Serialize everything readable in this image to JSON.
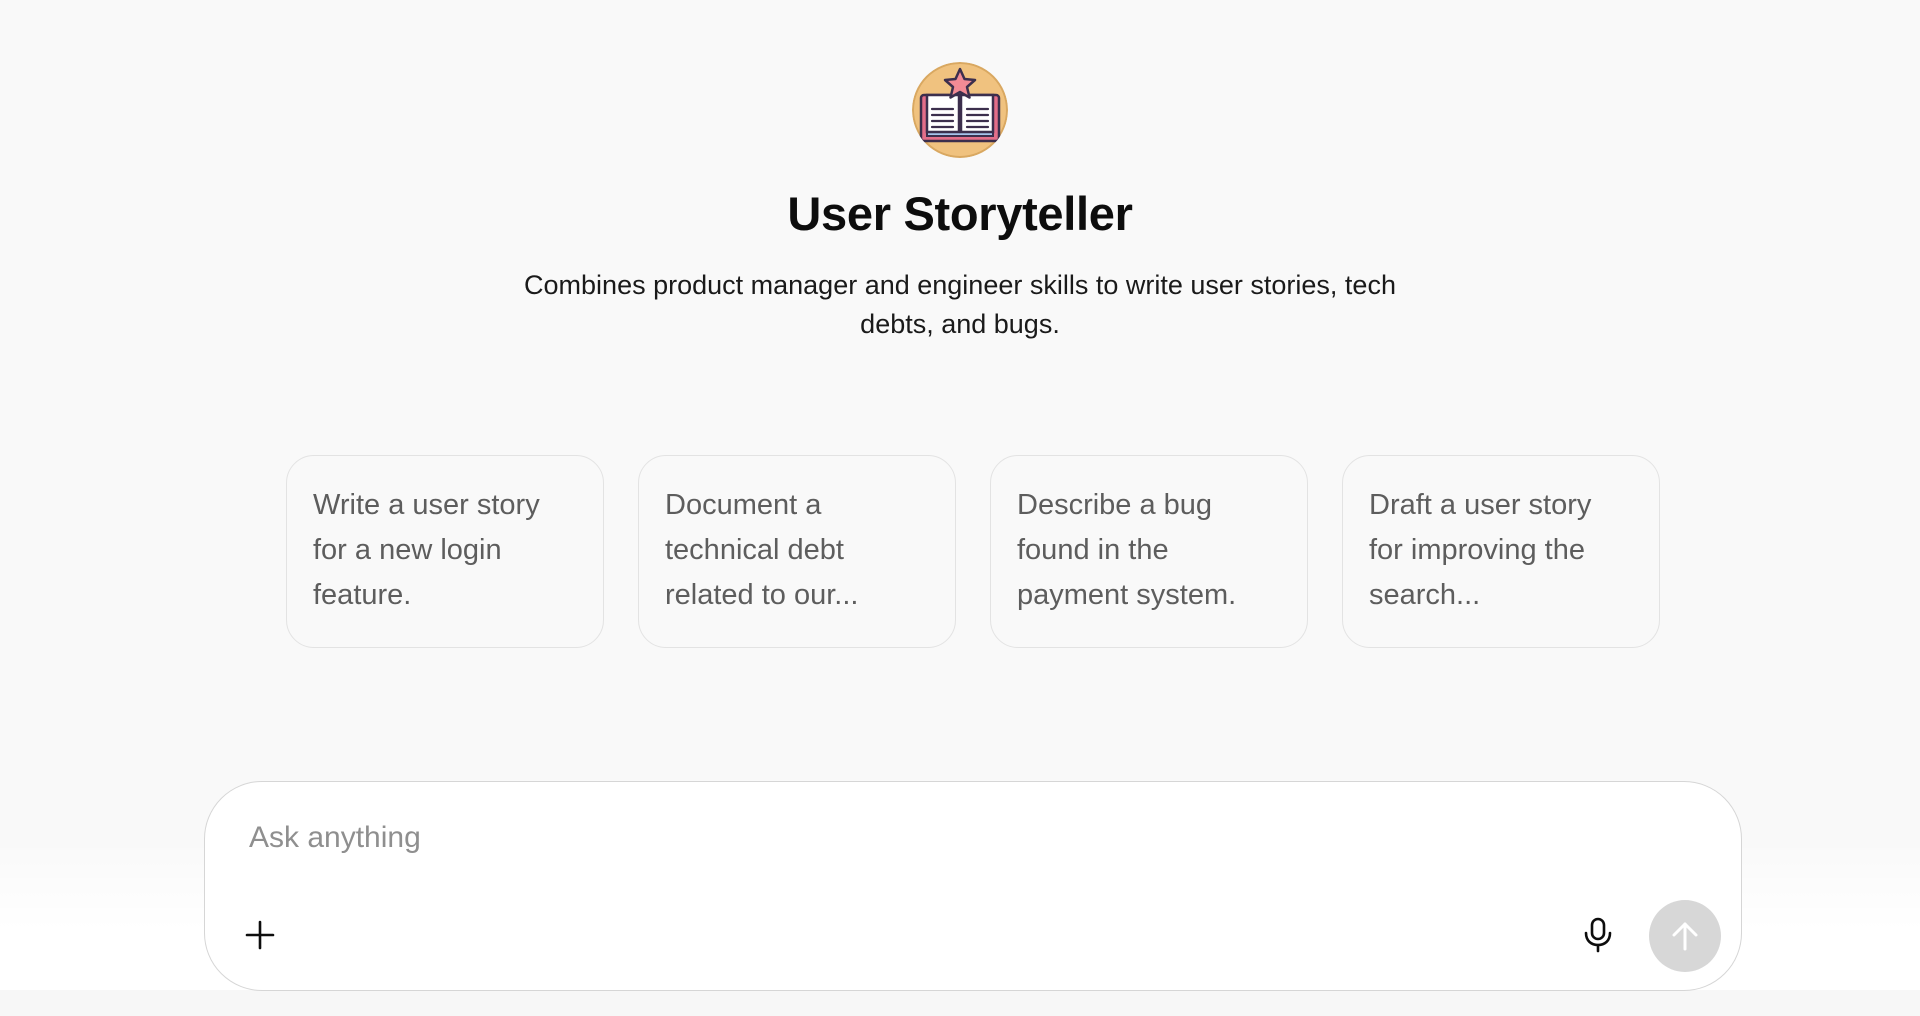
{
  "gpt": {
    "avatar_icon": "open-book-star-icon",
    "name": "User Storyteller",
    "description": "Combines product manager and engineer skills to write user stories, tech debts, and bugs."
  },
  "conversation_starters": [
    {
      "label": "Write a user story for a new login feature."
    },
    {
      "label": "Document a technical debt related to our..."
    },
    {
      "label": "Describe a bug found in the payment system."
    },
    {
      "label": "Draft a user story for improving the search..."
    }
  ],
  "composer": {
    "placeholder": "Ask anything",
    "value": "",
    "plus_icon": "plus-icon",
    "mic_icon": "microphone-icon",
    "send_icon": "arrow-up-icon"
  },
  "colors": {
    "background": "#f9f9f9",
    "avatar_bg": "#f0c27f",
    "star": "#f28b95",
    "send_disabled": "#d7d7d7"
  }
}
